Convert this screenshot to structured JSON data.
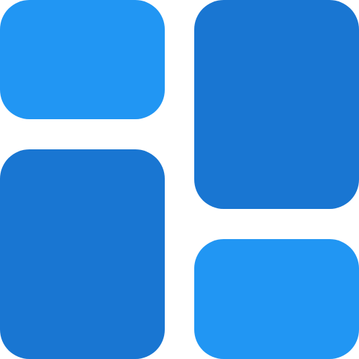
{
  "icon": {
    "name": "dashboard-layout-icon",
    "colors": {
      "light": "#2196F3",
      "dark": "#1976D2",
      "background": "#FFFFFF"
    },
    "tiles": [
      {
        "name": "tile-top-left",
        "shade": "light"
      },
      {
        "name": "tile-top-right",
        "shade": "dark"
      },
      {
        "name": "tile-bottom-left",
        "shade": "dark"
      },
      {
        "name": "tile-bottom-right",
        "shade": "light"
      }
    ]
  }
}
